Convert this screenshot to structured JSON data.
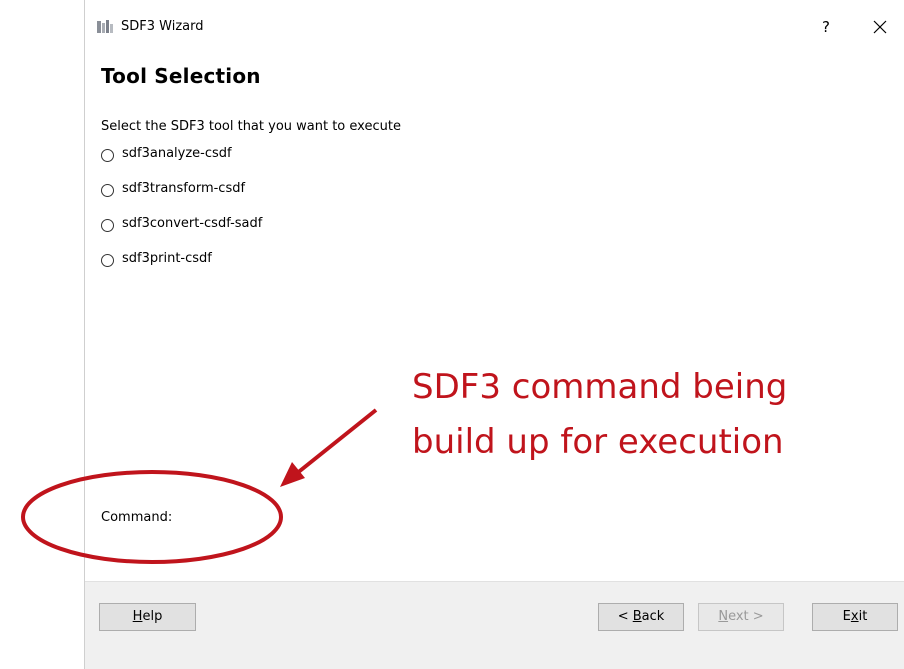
{
  "window": {
    "title": "SDF3 Wizard",
    "help_symbol": "?",
    "close_symbol": "×"
  },
  "page": {
    "title": "Tool Selection",
    "instruction": "Select the SDF3 tool that you want to execute",
    "options": [
      {
        "label": "sdf3analyze-csdf",
        "selected": false
      },
      {
        "label": "sdf3transform-csdf",
        "selected": false
      },
      {
        "label": "sdf3convert-csdf-sadf",
        "selected": false
      },
      {
        "label": "sdf3print-csdf",
        "selected": false
      }
    ],
    "command_label": "Command:"
  },
  "buttons": {
    "help": {
      "pre": "",
      "accel": "H",
      "post": "elp"
    },
    "back": {
      "pre": "< ",
      "accel": "B",
      "post": "ack"
    },
    "next": {
      "pre": "",
      "accel": "N",
      "post": "ext >"
    },
    "exit": {
      "pre": "E",
      "accel": "x",
      "post": "it"
    }
  },
  "annotation": {
    "line1": "SDF3 command being",
    "line2": "build up for execution",
    "color": "#c0141c"
  },
  "colors": {
    "button_bar": "#f0f0f0",
    "button_face": "#e1e1e1",
    "annotation_red": "#c0141c"
  },
  "icons": {
    "app": "sdf3-app-icon",
    "close": "close-icon"
  }
}
